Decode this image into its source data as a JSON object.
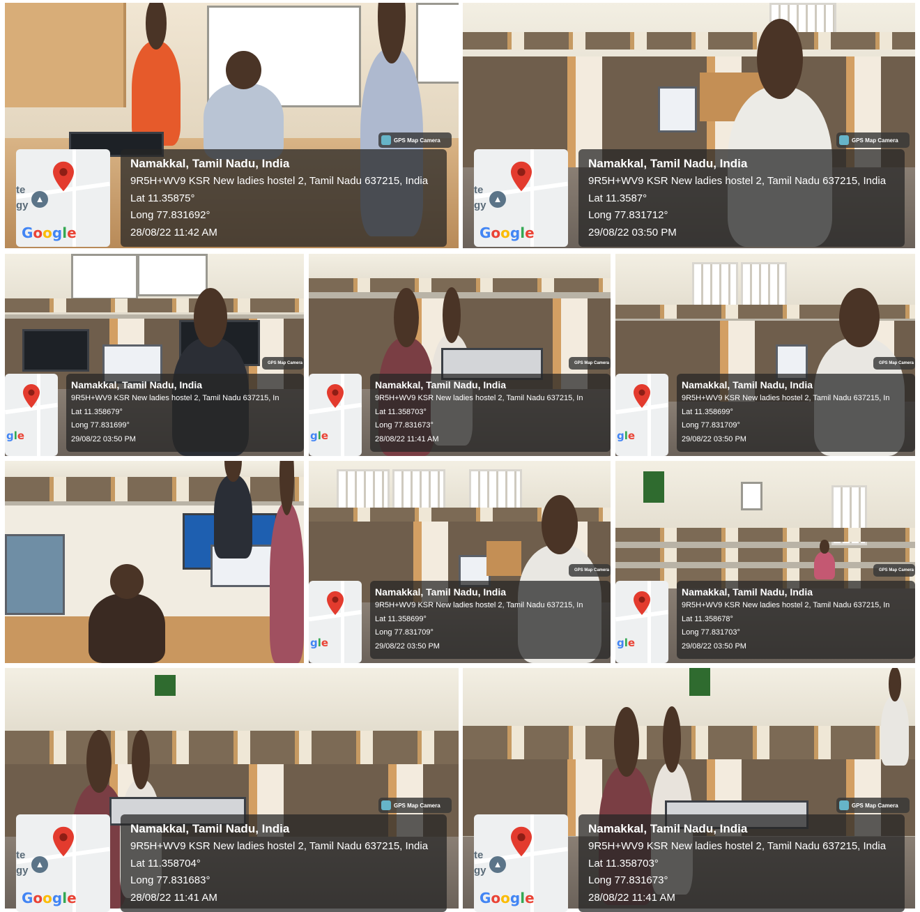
{
  "overlay_brand": "GPS Map Camera",
  "map_logo": "Google",
  "map_label_fragments": [
    "te",
    "gy"
  ],
  "map_pin_icon": "map-pin-icon",
  "colors": {
    "pin": "#e33b2e",
    "overlay": "#262626"
  },
  "photos": [
    {
      "city": "Namakkal, Tamil Nadu, India",
      "address": "9R5H+WV9 KSR New ladies hostel 2, Tamil Nadu 637215, India",
      "lat": "Lat 11.35875°",
      "long": "Long 77.831692°",
      "timestamp": "28/08/22 11:42 AM"
    },
    {
      "city": "Namakkal, Tamil Nadu, India",
      "address": "9R5H+WV9 KSR New ladies hostel 2, Tamil Nadu 637215, India",
      "lat": "Lat 11.3587°",
      "long": "Long 77.831712°",
      "timestamp": "29/08/22 03:50 PM"
    },
    {
      "city": "Namakkal, Tamil Nadu, India",
      "address": "9R5H+WV9 KSR New ladies hostel 2, Tamil Nadu 637215, In",
      "lat": "Lat 11.358679°",
      "long": "Long 77.831699°",
      "timestamp": "29/08/22 03:50 PM"
    },
    {
      "city": "Namakkal, Tamil Nadu, India",
      "address": "9R5H+WV9 KSR New ladies hostel 2, Tamil Nadu 637215, In",
      "lat": "Lat 11.358703°",
      "long": "Long 77.831673°",
      "timestamp": "28/08/22 11:41 AM"
    },
    {
      "city": "Namakkal, Tamil Nadu, India",
      "address": "9R5H+WV9 KSR New ladies hostel 2, Tamil Nadu 637215, In",
      "lat": "Lat 11.358699°",
      "long": "Long 77.831709°",
      "timestamp": "29/08/22 03:50 PM"
    },
    {
      "city": "",
      "address": "",
      "lat": "",
      "long": "",
      "timestamp": ""
    },
    {
      "city": "Namakkal, Tamil Nadu, India",
      "address": "9R5H+WV9 KSR New ladies hostel 2, Tamil Nadu 637215, In",
      "lat": "Lat 11.358699°",
      "long": "Long 77.831709°",
      "timestamp": "29/08/22 03:50 PM"
    },
    {
      "city": "Namakkal, Tamil Nadu, India",
      "address": "9R5H+WV9 KSR New ladies hostel 2, Tamil Nadu 637215, In",
      "lat": "Lat 11.358678°",
      "long": "Long 77.831703°",
      "timestamp": "29/08/22 03:50 PM"
    },
    {
      "city": "Namakkal, Tamil Nadu, India",
      "address": "9R5H+WV9 KSR New ladies hostel 2, Tamil Nadu 637215, India",
      "lat": "Lat 11.358704°",
      "long": "Long 77.831683°",
      "timestamp": "28/08/22 11:41 AM"
    },
    {
      "city": "Namakkal, Tamil Nadu, India",
      "address": "9R5H+WV9 KSR New ladies hostel 2, Tamil Nadu 637215, India",
      "lat": "Lat 11.358703°",
      "long": "Long 77.831673°",
      "timestamp": "28/08/22 11:41 AM"
    }
  ]
}
